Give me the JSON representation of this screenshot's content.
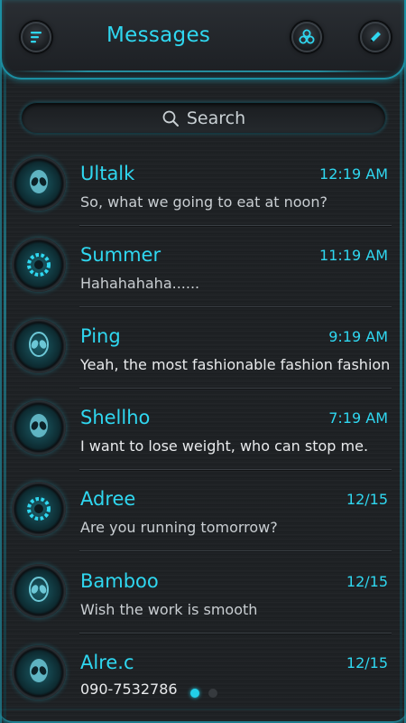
{
  "header": {
    "title": "Messages",
    "menu_icon": "menu-icon",
    "group_icon": "group-icon",
    "compose_icon": "pencil-icon"
  },
  "search": {
    "label": "Search",
    "icon": "search-icon"
  },
  "conversations": [
    {
      "name": "Ultalk",
      "time": "12:19 AM",
      "preview": "So, what we going to eat at noon?",
      "avatar": "alien-avatar"
    },
    {
      "name": "Summer",
      "time": "11:19 AM",
      "preview": "Hahahahaha......",
      "avatar": "ring-avatar"
    },
    {
      "name": "Ping",
      "time": "9:19 AM",
      "preview": "Yeah, the most fashionable fashion fashion..",
      "avatar": "alien-avatar"
    },
    {
      "name": "Shellho",
      "time": "7:19 AM",
      "preview": "I want to lose weight, who can stop me.",
      "avatar": "alien-avatar"
    },
    {
      "name": "Adree",
      "time": "12/15",
      "preview": "Are you running tomorrow?",
      "avatar": "ring-avatar"
    },
    {
      "name": "Bamboo",
      "time": "12/15",
      "preview": "Wish the work is smooth",
      "avatar": "alien-avatar"
    },
    {
      "name": "Alre.c",
      "time": "12/15",
      "preview": "090-7532786",
      "avatar": "alien-avatar"
    }
  ],
  "pager": {
    "pages": 2,
    "current": 1
  },
  "colors": {
    "accent": "#2fd7f0",
    "background": "#1e2124",
    "text": "#c9ced2"
  }
}
